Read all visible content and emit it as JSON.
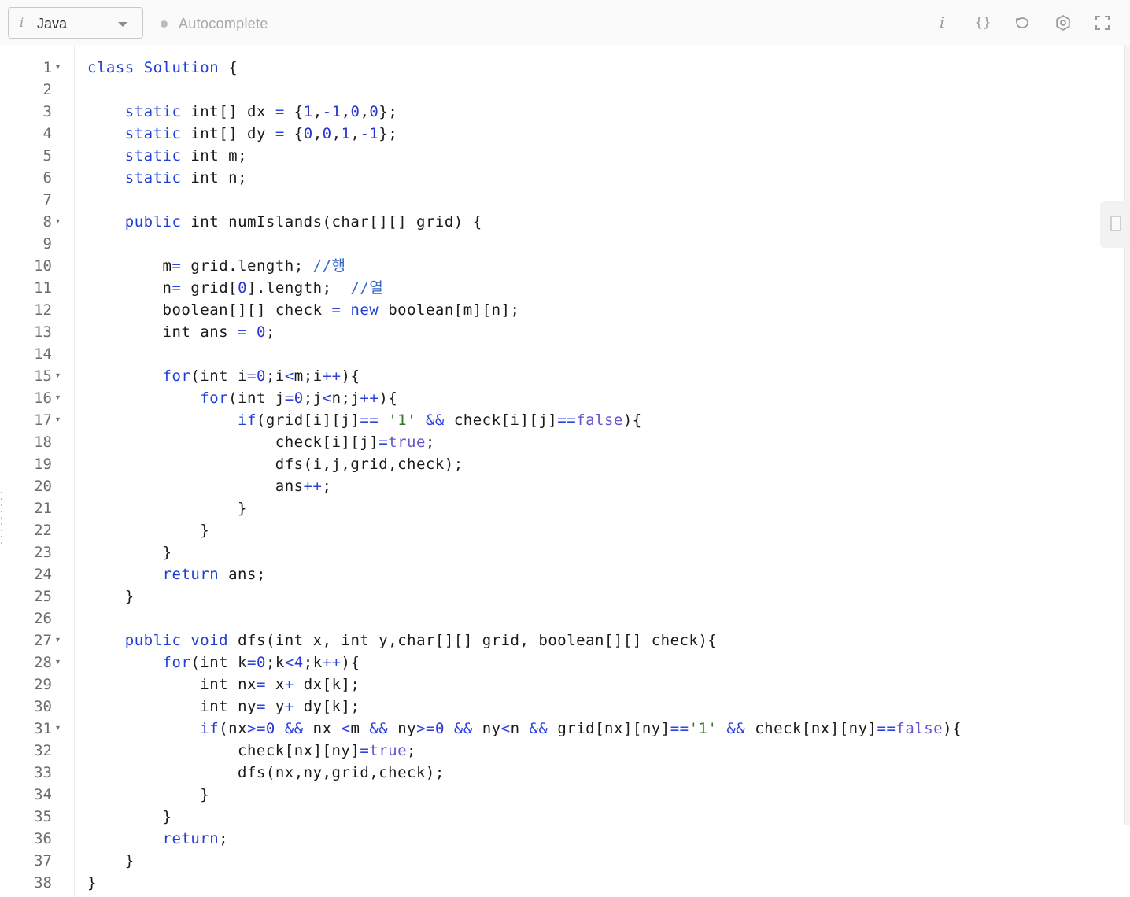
{
  "toolbar": {
    "language": "Java",
    "autocomplete_label": "Autocomplete",
    "icons": [
      "info-icon",
      "format-braces-icon",
      "reset-icon",
      "settings-icon",
      "fullscreen-icon"
    ]
  },
  "editor": {
    "line_numbers": [
      "1",
      "2",
      "3",
      "4",
      "5",
      "6",
      "7",
      "8",
      "9",
      "10",
      "11",
      "12",
      "13",
      "14",
      "15",
      "16",
      "17",
      "18",
      "19",
      "20",
      "21",
      "22",
      "23",
      "24",
      "25",
      "26",
      "27",
      "28",
      "29",
      "30",
      "31",
      "32",
      "33",
      "34",
      "35",
      "36",
      "37",
      "38"
    ],
    "foldable_lines": [
      1,
      8,
      15,
      16,
      17,
      27,
      28,
      31
    ],
    "lines": [
      "class Solution {",
      "",
      "    static int[] dx = {1,-1,0,0};",
      "    static int[] dy = {0,0,1,-1};",
      "    static int m;",
      "    static int n;",
      "",
      "    public int numIslands(char[][] grid) {",
      "",
      "        m= grid.length; //행",
      "        n= grid[0].length;  //열",
      "        boolean[][] check = new boolean[m][n];",
      "        int ans = 0;",
      "",
      "        for(int i=0;i<m;i++){",
      "            for(int j=0;j<n;j++){",
      "                if(grid[i][j]== '1' && check[i][j]==false){",
      "                    check[i][j]=true;",
      "                    dfs(i,j,grid,check);",
      "                    ans++;",
      "                }",
      "            }",
      "        }",
      "        return ans;",
      "    }",
      "",
      "    public void dfs(int x, int y,char[][] grid, boolean[][] check){",
      "        for(int k=0;k<4;k++){",
      "            int nx= x+ dx[k];",
      "            int ny= y+ dy[k];",
      "            if(nx>=0 && nx <m && ny>=0 && ny<n && grid[nx][ny]=='1' && check[nx][ny]==false){",
      "                check[nx][ny]=true;",
      "                dfs(nx,ny,grid,check);",
      "            }",
      "        }",
      "        return;",
      "    }",
      "}"
    ]
  },
  "colors": {
    "keyword": "#1f3fd6",
    "string": "#2e7d23",
    "boolean": "#6655cc",
    "comment": "#3567c7",
    "text": "#1a1a1a"
  }
}
